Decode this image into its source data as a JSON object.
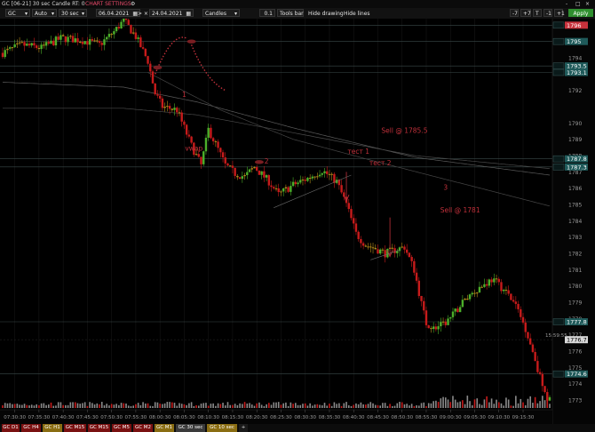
{
  "window": {
    "title": "GC [06-21] 30 sec Candle RT: 0",
    "settings_label": "CHART SETTINGS",
    "minimize": "-",
    "maximize": "□",
    "close": "×"
  },
  "toolbar": {
    "symbol": "GC",
    "scale_mode": "Auto",
    "interval": "30 sec",
    "date_from": "06.04.2021",
    "nav_next": "> ×",
    "date_to": "24.04.2021",
    "chart_type": "Candles",
    "step": "0.1",
    "tools_bar": "Tools bar",
    "hide_drawing": "Hide drawing",
    "hide_lines": "Hide lines",
    "zoom_buttons": [
      "-7",
      "+7",
      "T",
      "-1",
      "+1"
    ],
    "apply": "Apply"
  },
  "chart_data": {
    "type": "candlestick",
    "y_axis_labels": [
      "1796",
      "1794",
      "1792",
      "1790",
      "1789",
      "1788",
      "1787",
      "1786",
      "1785",
      "1784",
      "1783",
      "1782",
      "1781",
      "1780",
      "1779",
      "1778",
      "1777",
      "1776",
      "1775",
      "1774",
      "1773"
    ],
    "ylim": [
      1772.4,
      1796.4
    ],
    "x_axis_labels": [
      "07:30:30",
      "07:35:30",
      "07:40:30",
      "07:45:30",
      "07:50:30",
      "07:55:30",
      "08:00:30",
      "08:05:30",
      "08:10:30",
      "08:15:30",
      "08:20:30",
      "08:25:30",
      "08:30:30",
      "08:35:30",
      "08:40:30",
      "08:45:30",
      "08:50:30",
      "08:55:30",
      "09:00:30",
      "09:05:30",
      "09:10:30",
      "09:15:30"
    ],
    "price_levels": [
      {
        "label": "1796",
        "value": 1796.0,
        "color": "#c8323c"
      },
      {
        "label": "1795",
        "value": 1795.0,
        "color": "#1f5a5a"
      },
      {
        "label": "1793.5",
        "value": 1793.5,
        "color": "#1f5a5a"
      },
      {
        "label": "1793.1",
        "value": 1793.1,
        "color": "#1f5a5a"
      },
      {
        "label": "1787.8",
        "value": 1787.8,
        "color": "#1f5a5a"
      },
      {
        "label": "1787.3",
        "value": 1787.3,
        "color": "#1f5a5a"
      },
      {
        "label": "1777.8",
        "value": 1777.8,
        "color": "#1f5a5a"
      },
      {
        "label": "1774.6",
        "value": 1774.6,
        "color": "#1f5a5a"
      }
    ],
    "current_price": {
      "label": "1776.7",
      "value": 1776.7,
      "time_label": "15:59:55"
    },
    "annotations": [
      {
        "text": "1",
        "x": "08:05:30",
        "y": 1791.6
      },
      {
        "text": "vwap",
        "x": "08:07:30",
        "y": 1788.3
      },
      {
        "text": "2",
        "x": "08:22:30",
        "y": 1787.5
      },
      {
        "text": "тест 1",
        "x": "08:41:30",
        "y": 1788.1
      },
      {
        "text": "тест 2",
        "x": "08:46:00",
        "y": 1787.4
      },
      {
        "text": "Sell @ 1785.5",
        "x": "08:51:00",
        "y": 1789.4
      },
      {
        "text": "3",
        "x": "08:59:30",
        "y": 1785.9
      },
      {
        "text": "Sell @ 1781",
        "x": "09:02:30",
        "y": 1784.5
      }
    ],
    "price_path": [
      [
        0,
        1794.3
      ],
      [
        8,
        1794.8
      ],
      [
        16,
        1794.6
      ],
      [
        24,
        1795.2
      ],
      [
        32,
        1795.1
      ],
      [
        40,
        1794.8
      ],
      [
        46,
        1795.6
      ],
      [
        50,
        1796.3
      ],
      [
        55,
        1795.3
      ],
      [
        60,
        1793.8
      ],
      [
        63,
        1791.8
      ],
      [
        66,
        1791.0
      ],
      [
        72,
        1790.8
      ],
      [
        78,
        1788.6
      ],
      [
        82,
        1787.4
      ],
      [
        85,
        1789.6
      ],
      [
        88,
        1788.7
      ],
      [
        92,
        1787.4
      ],
      [
        96,
        1786.9
      ],
      [
        100,
        1786.7
      ],
      [
        104,
        1787.3
      ],
      [
        110,
        1786.4
      ],
      [
        114,
        1785.6
      ],
      [
        120,
        1786.2
      ],
      [
        126,
        1786.6
      ],
      [
        132,
        1787.1
      ],
      [
        138,
        1786.4
      ],
      [
        142,
        1785.0
      ],
      [
        146,
        1783.2
      ],
      [
        150,
        1782.5
      ],
      [
        154,
        1782.3
      ],
      [
        158,
        1782.0
      ],
      [
        162,
        1782.2
      ],
      [
        166,
        1782.4
      ],
      [
        170,
        1781.0
      ],
      [
        173,
        1778.9
      ],
      [
        175,
        1777.7
      ],
      [
        178,
        1777.4
      ],
      [
        182,
        1777.6
      ],
      [
        186,
        1778.2
      ],
      [
        190,
        1779.0
      ],
      [
        194,
        1779.6
      ],
      [
        198,
        1780.0
      ],
      [
        202,
        1780.4
      ],
      [
        205,
        1780.1
      ],
      [
        208,
        1779.6
      ],
      [
        212,
        1778.8
      ],
      [
        216,
        1777.4
      ],
      [
        220,
        1775.5
      ],
      [
        224,
        1773.3
      ],
      [
        226,
        1773.0
      ]
    ],
    "moving_averages": [
      {
        "name": "ma-1",
        "color": "#5a5a5a",
        "points": [
          [
            0,
            1792.5
          ],
          [
            50,
            1792.2
          ],
          [
            80,
            1791.3
          ],
          [
            120,
            1789.7
          ],
          [
            170,
            1787.9
          ],
          [
            226,
            1786.8
          ]
        ]
      },
      {
        "name": "ma-2",
        "color": "#4a4a4a",
        "points": [
          [
            0,
            1790.9
          ],
          [
            50,
            1790.9
          ],
          [
            80,
            1790.5
          ],
          [
            120,
            1789.4
          ],
          [
            170,
            1788.0
          ],
          [
            226,
            1787.2
          ]
        ]
      },
      {
        "name": "ma-3",
        "color": "#454545",
        "points": [
          [
            60,
            1793.1
          ],
          [
            90,
            1790.8
          ],
          [
            120,
            1789.0
          ],
          [
            150,
            1787.8
          ],
          [
            226,
            1784.9
          ]
        ]
      }
    ]
  },
  "bottom_tabs": [
    {
      "label": "GC D1",
      "style": "red"
    },
    {
      "label": "GC H4",
      "style": "red"
    },
    {
      "label": "GC H1",
      "style": "gold"
    },
    {
      "label": "GC M15",
      "style": "red"
    },
    {
      "label": "GC M15",
      "style": "red"
    },
    {
      "label": "GC M5",
      "style": "red"
    },
    {
      "label": "GC M2",
      "style": "red"
    },
    {
      "label": "GC M1",
      "style": "gold"
    },
    {
      "label": "GC 30 sec",
      "style": "gray"
    },
    {
      "label": "GC 10 sec",
      "style": "gold"
    },
    {
      "label": "+",
      "style": "add"
    }
  ],
  "colors": {
    "bull": "#4caf2a",
    "bear": "#c71b1b",
    "mixed": "#b38a1a",
    "annotation": "#c0303a",
    "grid": "#1a1a1a"
  }
}
